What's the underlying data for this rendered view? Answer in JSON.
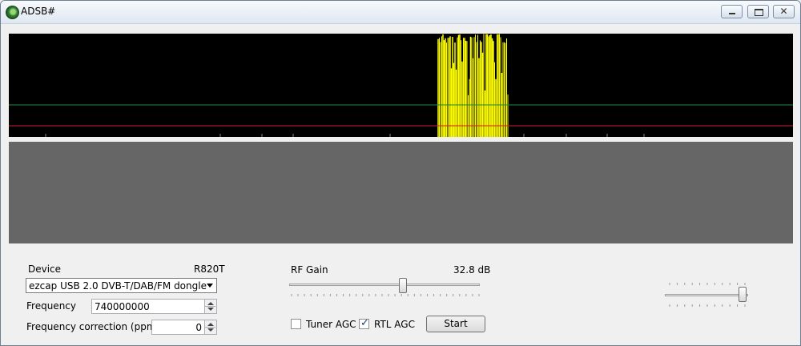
{
  "window": {
    "title": "ADSB#",
    "controls": {
      "minimize_icon": "minimize-icon",
      "maximize_icon": "maximize-icon",
      "close_icon": "close-icon"
    }
  },
  "device": {
    "label": "Device",
    "tuner": "R820T",
    "selected": "ezcap USB 2.0 DVB-T/DAB/FM dongle"
  },
  "frequency": {
    "label": "Frequency",
    "value": "740000000"
  },
  "frequency_correction": {
    "label": "Frequency correction (ppm)",
    "value": "0"
  },
  "rf_gain": {
    "label": "RF Gain",
    "value_text": "32.8 dB",
    "level": 0.6
  },
  "tuner_agc": {
    "label": "Tuner AGC",
    "checked": false
  },
  "rtl_agc": {
    "label": "RTL AGC",
    "checked": true
  },
  "start_button": {
    "label": "Start"
  },
  "threshold_slider": {
    "level": 1.0
  },
  "colors": {
    "spectrum_bg": "#000000",
    "signal": "#ffff00",
    "threshold_green": "#1f8a3b",
    "threshold_red": "#d0202a",
    "waterfall_bg": "#666666"
  }
}
